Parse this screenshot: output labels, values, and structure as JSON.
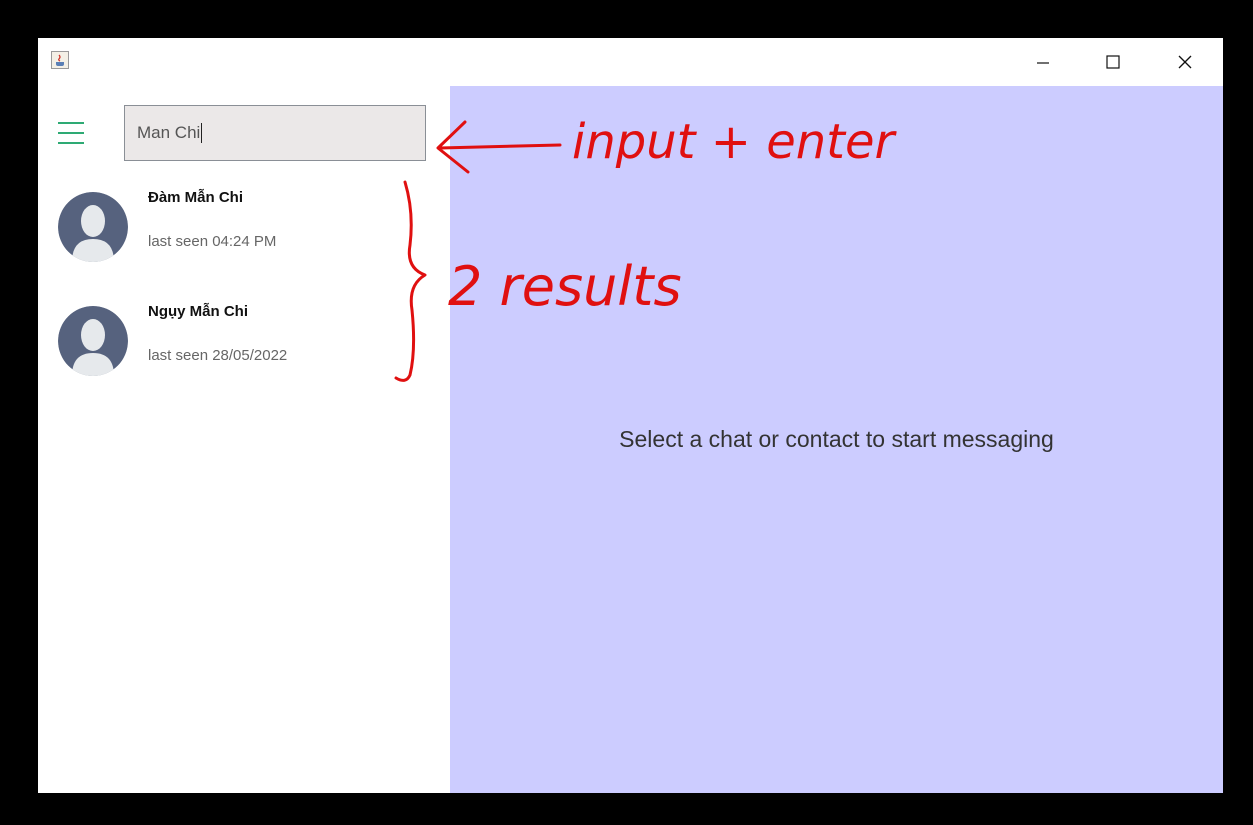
{
  "window": {
    "icon": "java-cup-icon",
    "controls": [
      "minimize-icon",
      "maximize-icon",
      "close-icon"
    ]
  },
  "sidebar": {
    "menu_icon": "hamburger-menu-icon",
    "search": {
      "value": "Man Chi"
    },
    "results": [
      {
        "name": "Đàm Mẫn Chi",
        "last_seen": "last seen 04:24 PM",
        "avatar": "default-user-avatar"
      },
      {
        "name": "Ngụy Mẫn Chi",
        "last_seen": "last seen 28/05/2022",
        "avatar": "default-user-avatar"
      }
    ]
  },
  "chat": {
    "empty_message": "Select a chat or contact to start messaging"
  },
  "annotations": {
    "arrow_text": "input + enter",
    "brace_text": "2 results",
    "color": "#e01010"
  },
  "colors": {
    "accent": "#2eaa74",
    "chat_bg": "#ccccff",
    "avatar": "#56627e"
  }
}
